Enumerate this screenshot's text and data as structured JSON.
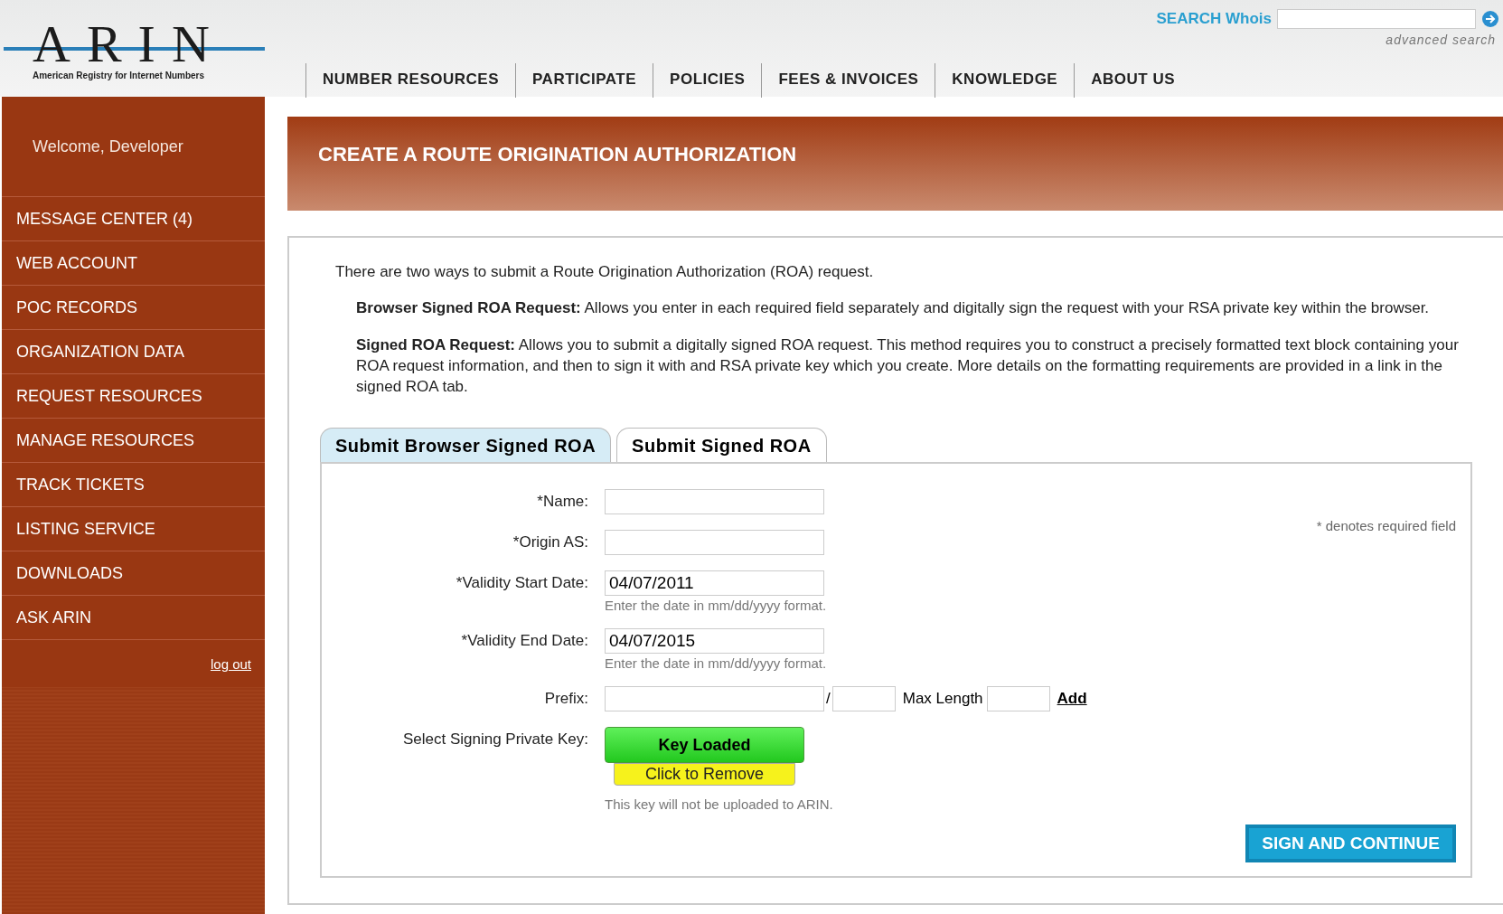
{
  "header": {
    "logo": {
      "name": "ARIN",
      "tagline": "American Registry for Internet Numbers"
    },
    "search": {
      "label": "SEARCH Whois",
      "link": "advanced search"
    },
    "nav": [
      "NUMBER RESOURCES",
      "PARTICIPATE",
      "POLICIES",
      "FEES & INVOICES",
      "KNOWLEDGE",
      "ABOUT US"
    ]
  },
  "sidebar": {
    "welcome": "Welcome, Developer",
    "items": [
      "MESSAGE CENTER (4)",
      "WEB ACCOUNT",
      "POC RECORDS",
      "ORGANIZATION DATA",
      "REQUEST RESOURCES",
      "MANAGE RESOURCES",
      "TRACK TICKETS",
      "LISTING SERVICE",
      "DOWNLOADS",
      "ASK ARIN"
    ],
    "logout": "log out"
  },
  "page_title": "CREATE A ROUTE ORIGINATION AUTHORIZATION",
  "intro": "There are two ways to submit a Route Origination Authorization (ROA) request.",
  "options": [
    "**Browser Signed ROA Request:** Allows you enter in each required field separately and digitally sign the request with your RSA private key within the browser.",
    "**Signed ROA Request:** Allows you to submit a digitally signed ROA request. This method requires you to construct a precisely formatted text block containing your ROA request information, and then to sign it with and RSA private key which you create. More details on the formatting requirements are provided in a link in the signed ROA tab."
  ],
  "tabs": [
    {
      "label": "Submit Browser Signed ROA",
      "selected": true
    },
    {
      "label": "Submit Signed ROA",
      "selected": false
    }
  ],
  "required_note": "* denotes required field",
  "fields": [
    {
      "label": "*Name:"
    },
    {
      "label": "*Origin AS:"
    },
    {
      "label": "*Validity Start Date:",
      "value": "04/07/2011",
      "hint": "Enter the date in mm/dd/yyyy format."
    },
    {
      "label": "*Validity End Date:",
      "value": "04/07/2015",
      "hint": "Enter the date in mm/dd/yyyy format."
    }
  ],
  "prefix": {
    "label": "Prefix:",
    "separator": "/",
    "max_length_label": "Max Length",
    "add": "Add"
  },
  "key": {
    "label": "Select Signing Private Key:",
    "status": "Key Loaded",
    "action": "Click to Remove",
    "note": "This key will not be uploaded to ARIN."
  },
  "submit": "SIGN AND CONTINUE"
}
